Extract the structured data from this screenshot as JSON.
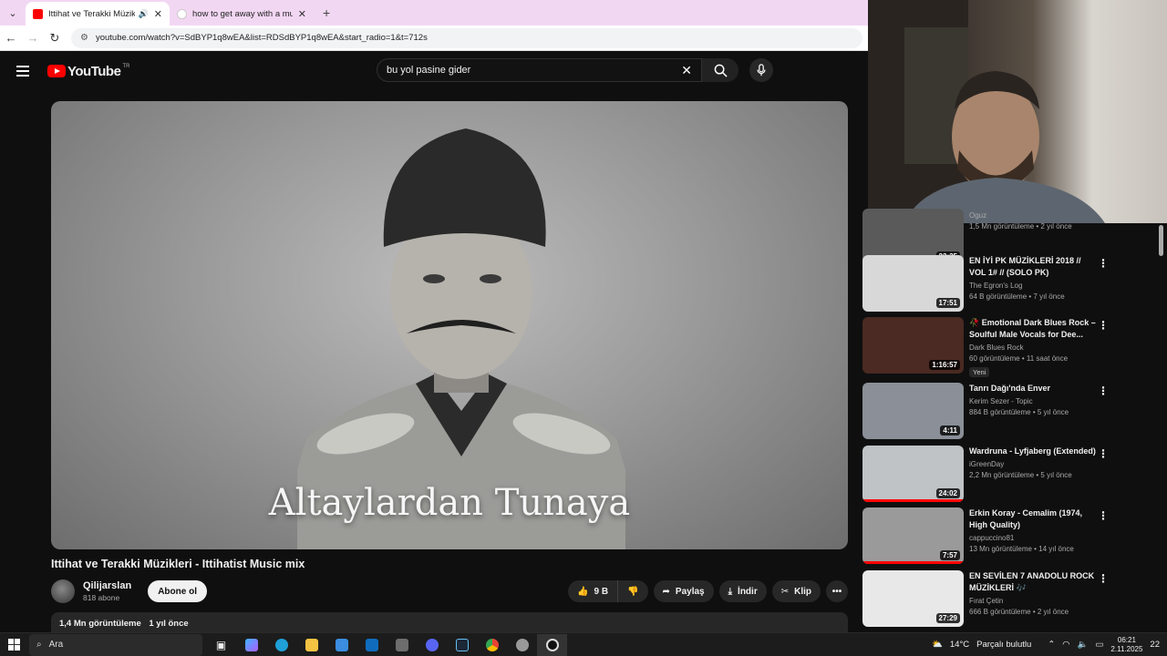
{
  "browser": {
    "tabs": [
      {
        "title": "Ittihat ve Terakki Müzikleri",
        "active": true
      },
      {
        "title": "how to get away with a murder",
        "active": false
      }
    ],
    "url": "youtube.com/watch?v=SdBYP1q8wEA&list=RDSdBYP1q8wEA&start_radio=1&t=712s"
  },
  "yt": {
    "logo_text": "YouTube",
    "country": "TR",
    "search_value": "bu yol pasine gider"
  },
  "video": {
    "overlay_text": "Altaylardan Tunaya",
    "title": "Ittihat ve Terakki Müzikleri - Ittihatist Music mix",
    "channel": "Qilijarslan",
    "subscribers": "818 abone",
    "subscribe_label": "Abone ol",
    "likes": "9 B",
    "share_label": "Paylaş",
    "download_label": "İndir",
    "clip_label": "Klip",
    "views": "1,4 Mn görüntüleme",
    "age": "1 yıl önce"
  },
  "recommendations": [
    {
      "title": "",
      "channel": "Oguz",
      "views": "1,5 Mn görüntüleme • 2 yıl önce",
      "duration": "23:35",
      "progress": 1.0,
      "new": false,
      "thumb_color": "#5a5a5a"
    },
    {
      "title": "EN İYİ PK MÜZİKLERİ 2018 // VOL 1# // (SOLO PK)",
      "channel": "The Egron's Log",
      "views": "64 B görüntüleme • 7 yıl önce",
      "duration": "17:51",
      "progress": 0,
      "new": false,
      "thumb_color": "#d8d8d8"
    },
    {
      "title": "🥀 Emotional Dark Blues Rock – Soulful Male Vocals for Dee...",
      "channel": "Dark Blues Rock",
      "views": "60 görüntüleme • 11 saat önce",
      "duration": "1:16:57",
      "progress": 0,
      "new": true,
      "new_label": "Yeni",
      "thumb_color": "#4a2a22"
    },
    {
      "title": "Tanrı Dağı'nda Enver",
      "channel": "Kerim Sezer - Topic",
      "views": "884 B görüntüleme • 5 yıl önce",
      "duration": "4:11",
      "progress": 0,
      "new": false,
      "thumb_color": "#8a8f98"
    },
    {
      "title": "Wardruna - Lyfjaberg (Extended)",
      "channel": "iGreenDay",
      "views": "2,2 Mn görüntüleme • 5 yıl önce",
      "duration": "24:02",
      "progress": 1.0,
      "new": false,
      "thumb_color": "#bfc3c6"
    },
    {
      "title": "Erkin Koray - Cemalim (1974, High Quality)",
      "channel": "cappuccino81",
      "views": "13 Mn görüntüleme • 14 yıl önce",
      "duration": "7:57",
      "progress": 1.0,
      "new": false,
      "thumb_color": "#9a9a9a"
    },
    {
      "title": "EN SEVİLEN 7 ANADOLU ROCK MÜZİKLERİ 🎶",
      "channel": "Fırat Çetin",
      "views": "666 B görüntüleme • 2 yıl önce",
      "duration": "27:29",
      "progress": 0,
      "new": false,
      "thumb_color": "#e8e8e8"
    }
  ],
  "taskbar": {
    "search_label": "Ara",
    "weather": "14°C",
    "weather_desc": "Parçalı bulutlu",
    "time": "06:21",
    "date": "2.11.2025",
    "notif_count": "22"
  }
}
